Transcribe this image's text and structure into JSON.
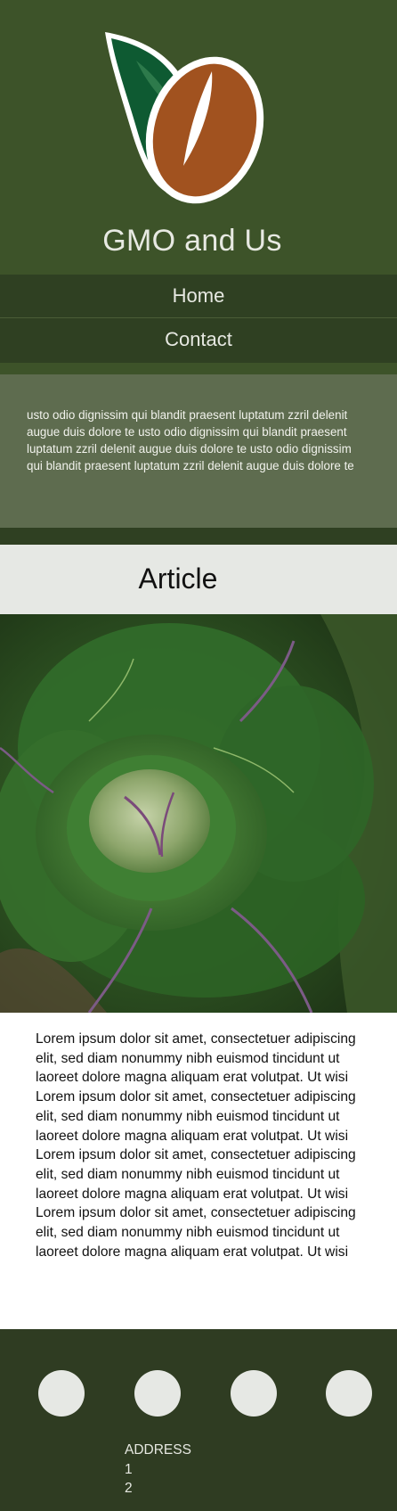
{
  "header": {
    "logo_icon": "coffee-bean-leaf-logo",
    "title": "GMO and Us",
    "colors": {
      "background": "#3d5329",
      "leaf": "#0e5a32",
      "bean": "#a1521f"
    }
  },
  "nav": {
    "items": [
      {
        "label": "Home"
      },
      {
        "label": "Contact"
      }
    ]
  },
  "intro": {
    "text": "usto odio dignissim qui blandit praesent luptatum zzril delenit augue duis dolore te usto odio dignissim qui blandit praesent luptatum zzril delenit augue duis dolore te usto odio dignissim qui blandit praesent luptatum zzril delenit augue duis dolore te"
  },
  "article": {
    "title": "Article",
    "image_description_icon": "cabbage-photo",
    "body": "Lorem ipsum dolor sit amet, consectetuer adipiscing elit, sed diam nonummy nibh euismod tincidunt ut laoreet dolore magna aliquam erat volutpat. Ut wisi Lorem ipsum dolor sit amet, consectetuer adipiscing elit, sed diam nonummy nibh euismod tincidunt ut laoreet dolore magna aliquam erat volutpat. Ut wisi Lorem ipsum dolor sit amet, consectetuer adipiscing elit, sed diam nonummy nibh euismod tincidunt ut laoreet dolore magna aliquam erat volutpat. Ut wisi Lorem ipsum dolor sit amet, consectetuer adipiscing elit, sed diam nonummy nibh euismod tincidunt ut laoreet dolore magna aliquam erat volutpat. Ut wisi"
  },
  "footer": {
    "social_icons": [
      "social-circle-icon",
      "social-circle-icon",
      "social-circle-icon",
      "social-circle-icon"
    ],
    "address_label": "ADDRESS",
    "address_line_1": "1",
    "address_line_2": "2"
  }
}
